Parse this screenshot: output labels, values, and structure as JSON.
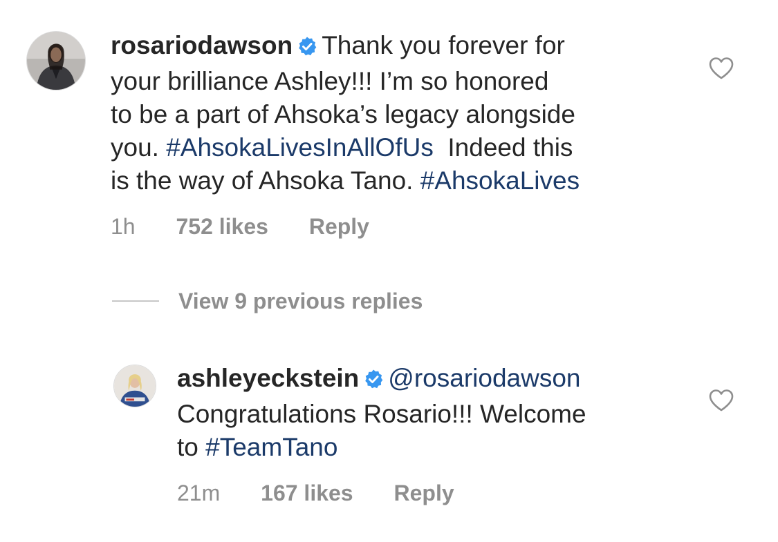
{
  "comment": {
    "username": "rosariodawson",
    "text_lines": [
      "Thank you forever for",
      "your brilliance Ashley!!! I’m so honored",
      "to be a part of Ahsoka’s legacy alongside"
    ],
    "line4_prefix": "you. ",
    "hashtag_1": "#AhsokaLivesInAllOfUs",
    "line4_suffix": "  Indeed this",
    "line5_prefix": "is the way of Ahsoka Tano. ",
    "hashtag_2": "#AhsokaLives",
    "time": "1h",
    "likes": "752 likes",
    "reply_label": "Reply",
    "like_icon": "heart-outline-icon"
  },
  "view_replies": {
    "label": "View 9 previous replies"
  },
  "reply": {
    "username": "ashleyeckstein",
    "mention": "@rosariodawson",
    "line2": "Congratulations Rosario!!! Welcome",
    "line3_prefix": "to ",
    "hashtag": "#TeamTano",
    "time": "21m",
    "likes": "167 likes",
    "reply_label": "Reply",
    "like_icon": "heart-outline-icon"
  },
  "colors": {
    "text": "#262626",
    "link": "#1b3a69",
    "meta": "#8e8e8e",
    "verified": "#3897f0"
  }
}
